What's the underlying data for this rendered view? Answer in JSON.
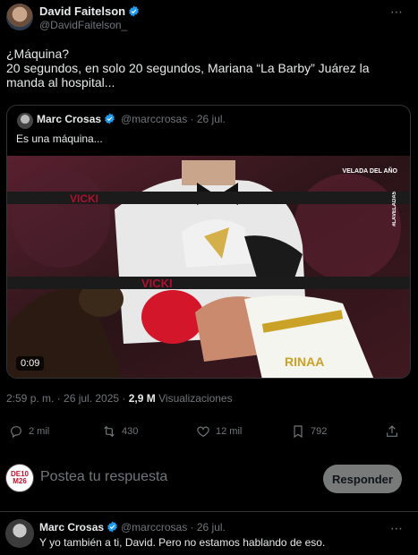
{
  "tweet": {
    "author_name": "David Faitelson",
    "author_handle": "@DavidFaitelson_",
    "text_line1": "¿Máquina?",
    "text_line2": "20 segundos, en solo 20 segundos, Mariana “La Barby” Juárez la manda al hospital...",
    "timestamp": "2:59 p. m. · 26 jul. 2025 ·",
    "views_count": "2,9 M",
    "views_label": "Visualizaciones",
    "more_icon": "⋯"
  },
  "quote": {
    "author_name": "Marc Crosas",
    "meta": "@marccrosas · 26 jul.",
    "text": "Es una máquina...",
    "video_duration": "0:09",
    "video_overlay": {
      "logo": "VELADA DEL AÑO",
      "tag": "#LAVELADA5",
      "rope_text": "VICKI"
    }
  },
  "actions": {
    "replies": "2 mil",
    "reposts": "430",
    "likes": "12 mil",
    "bookmarks": "792"
  },
  "reply_box": {
    "avatar_text": "DE10 M26",
    "placeholder": "Postea tu respuesta",
    "button_label": "Responder"
  },
  "reply": {
    "author_name": "Marc Crosas",
    "meta": "@marccrosas · 26 jul.",
    "text": "Y yo también a ti, David. Pero no estamos hablando de eso.",
    "more_icon": "⋯"
  },
  "colors": {
    "background": "#000000",
    "text_primary": "#e7e9ea",
    "text_secondary": "#71767b",
    "verified_blue": "#1d9bf0",
    "border": "#2f3336",
    "button_bg": "#787a7a"
  }
}
